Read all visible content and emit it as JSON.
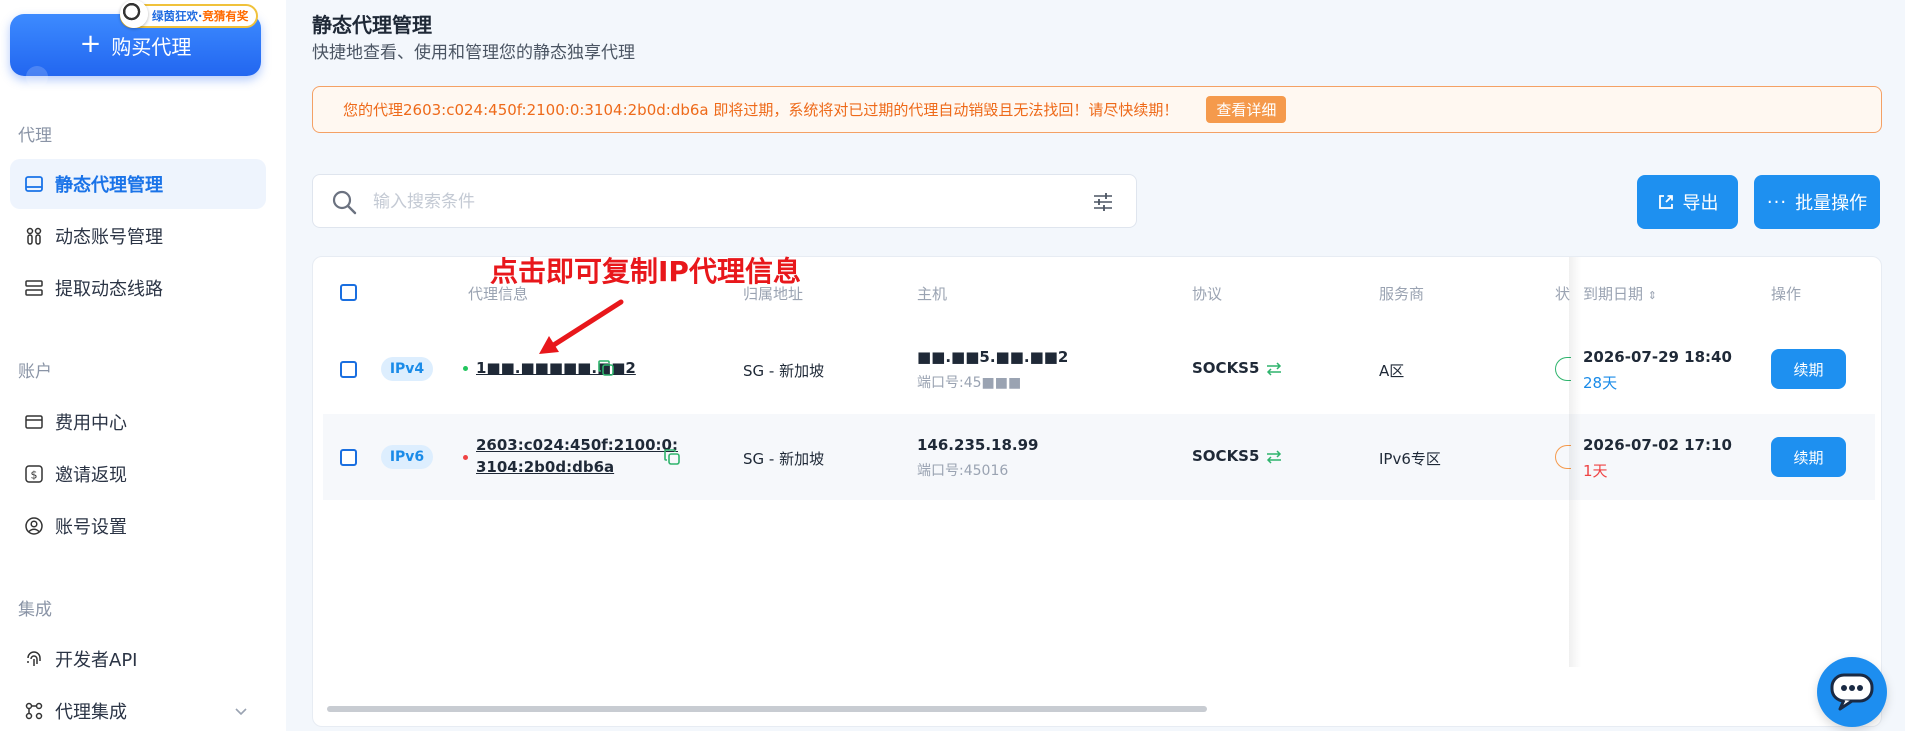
{
  "sidebar": {
    "buy_label": "购买代理",
    "promo": {
      "text_main": "绿茵狂欢·",
      "text_highlight": "竞猜有奖"
    },
    "sections": {
      "proxy": "代理",
      "account": "账户",
      "integration": "集成"
    },
    "items": [
      {
        "label": "静态代理管理",
        "icon": "server-icon",
        "active": true
      },
      {
        "label": "动态账号管理",
        "icon": "users-icon"
      },
      {
        "label": "提取动态线路",
        "icon": "list-icon"
      },
      {
        "label": "费用中心",
        "icon": "wallet-icon"
      },
      {
        "label": "邀请返现",
        "icon": "dollar-icon"
      },
      {
        "label": "账号设置",
        "icon": "user-circle-icon"
      },
      {
        "label": "开发者API",
        "icon": "fingerprint-icon"
      },
      {
        "label": "代理集成",
        "icon": "integration-icon"
      }
    ]
  },
  "header": {
    "title": "静态代理管理",
    "subtitle": "快捷地查看、使用和管理您的静态独享代理"
  },
  "alert": {
    "text": "您的代理2603:c024:450f:2100:0:3104:2b0d:db6a 即将过期，系统将对已过期的代理自动销毁且无法找回！请尽快续期！",
    "button": "查看详细",
    "color": "#ee6a1a"
  },
  "search": {
    "placeholder": "输入搜索条件"
  },
  "toolbar": {
    "export_label": "导出",
    "batch_label": "批量操作"
  },
  "table": {
    "columns": [
      "代理信息",
      "归属地址",
      "主机",
      "协议",
      "服务商",
      "状",
      "到期日期",
      "操作"
    ],
    "rows": [
      {
        "type": "IPv4",
        "status_color": "#22c55e",
        "ip_line1": "1■■.■■■■■.■■2",
        "ip_line2": "",
        "location": "SG - 新加坡",
        "host": "■■.■■5.■■.■■2",
        "port": "端口号:45■■■",
        "protocol": "SOCKS5",
        "provider": "A区",
        "expire_date": "2026-07-29 18:40",
        "remaining": "28天",
        "remaining_color": "#1a8be8",
        "action": "续期"
      },
      {
        "type": "IPv6",
        "status_color": "#ef4444",
        "ip_line1": "2603:c024:450f:2100:0:",
        "ip_line2": "3104:2b0d:db6a",
        "location": "SG - 新加坡",
        "host": "146.235.18.99",
        "port": "端口号:45016",
        "protocol": "SOCKS5",
        "provider": "IPv6专区",
        "expire_date": "2026-07-02 17:10",
        "remaining": "1天",
        "remaining_color": "#ef4444",
        "action": "续期"
      }
    ]
  },
  "annotation": {
    "text": "点击即可复制IP代理信息",
    "color": "#e8171b"
  },
  "colors": {
    "accent": "#1e90f0",
    "active_nav": "#1a73e8",
    "warning": "#ee6a1a"
  }
}
